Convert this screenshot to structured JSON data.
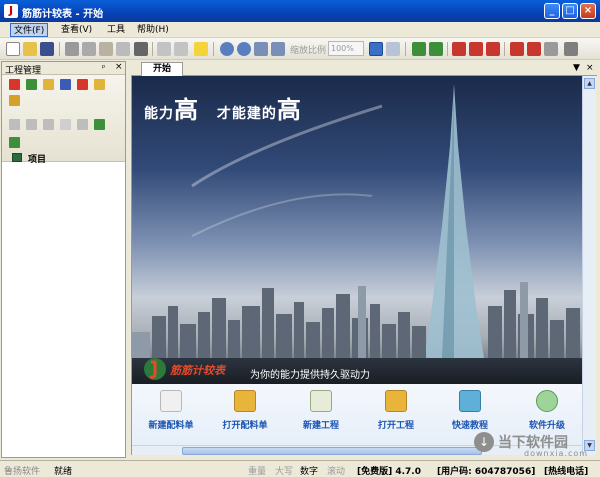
{
  "window": {
    "title": "筋筋计较表 - 开始",
    "logo_glyph": "J"
  },
  "winbtns": {
    "minimize": "_",
    "maximize": "□",
    "close": "×"
  },
  "menus": [
    "文件(F)",
    "查看(V)",
    "工具",
    "帮助(H)"
  ],
  "toolbar": {
    "zoom_label": "缩放比例",
    "zoom_value": "100%"
  },
  "panel": {
    "title": "工程管理",
    "pin": "ᵖ",
    "close": "×",
    "tree_root": "项目"
  },
  "tab": {
    "label": "开始",
    "ctl_arrow": "▼",
    "ctl_close": "×"
  },
  "banner": {
    "slogan_part1": "能力",
    "slogan_big1": "高",
    "slogan_part2": "才能建的",
    "slogan_big2": "高",
    "logo_text": "筋筋计较表",
    "tagline": "为你的能力提供持久驱动力"
  },
  "actions": [
    "新建配料单",
    "打开配料单",
    "新建工程",
    "打开工程",
    "快速教程",
    "软件升级"
  ],
  "status": {
    "company": "鲁扬软件",
    "state": "就绪",
    "keys": [
      "重量",
      "大写",
      "数字",
      "滚动"
    ],
    "edition": "[免费版] 4.7.0",
    "user": "[用户码: 604787056]",
    "hotline": "[热线电话]"
  },
  "watermark": {
    "text": "当下软件园",
    "sub": "downxia.com"
  },
  "colors": {
    "accent": "#316ac5",
    "action_text": "#1b55b3",
    "title_blue": "#0842b8"
  }
}
